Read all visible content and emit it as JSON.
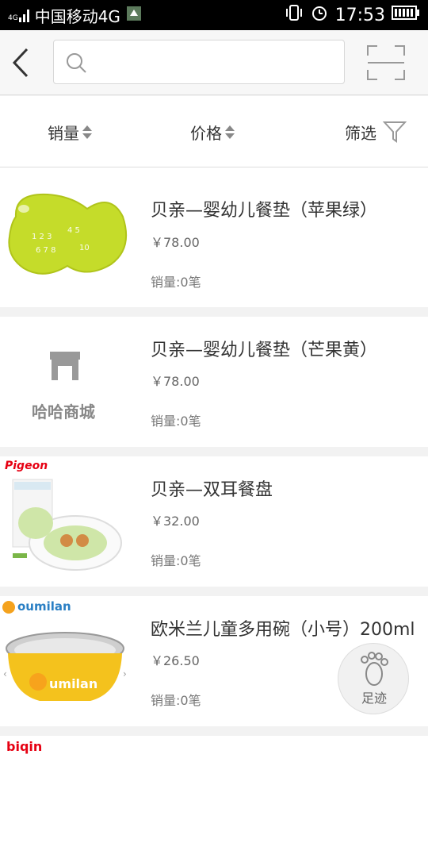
{
  "statusbar": {
    "network_badge": "4G",
    "carrier": "中国移动4G",
    "time": "17:53"
  },
  "search": {
    "placeholder": ""
  },
  "sort": {
    "sales_label": "销量",
    "price_label": "价格",
    "filter_label": "筛选"
  },
  "products": [
    {
      "title": "贝亲—婴幼儿餐垫（苹果绿）",
      "price": "￥78.00",
      "sales": "销量:0笔",
      "image": "green-placemat"
    },
    {
      "title": "贝亲—婴幼儿餐垫（芒果黄）",
      "price": "￥78.00",
      "sales": "销量:0笔",
      "image": "placeholder-store",
      "placeholder_text": "哈哈商城"
    },
    {
      "title": "贝亲—双耳餐盘",
      "price": "￥32.00",
      "sales": "销量:0笔",
      "image": "pigeon-plate",
      "brand": "Pigeon"
    },
    {
      "title": "欧米兰儿童多用碗（小号）200ml",
      "price": "￥26.50",
      "sales": "销量:0笔",
      "image": "oumilan-bowl",
      "brand": "oumilan"
    },
    {
      "title": "",
      "price": "",
      "sales": "",
      "image": "biqin-product",
      "brand": "biqin"
    }
  ],
  "footprint": {
    "label": "足迹"
  },
  "colors": {
    "accent_green": "#c5dc2a",
    "bowl_yellow": "#f4c21d",
    "brand_red": "#e60012"
  }
}
